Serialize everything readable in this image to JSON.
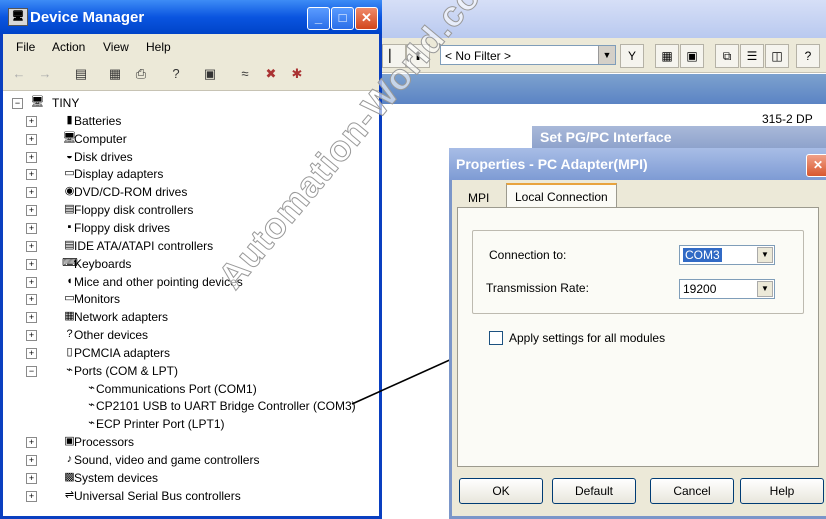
{
  "device_manager": {
    "title": "Device Manager",
    "controls": {
      "minimize": "_",
      "maximize": "□",
      "close": "✕"
    },
    "menu": [
      "File",
      "Action",
      "View",
      "Help"
    ],
    "tree": [
      {
        "label": "TINY",
        "level": 0,
        "state": "-",
        "icon": "computer-icon"
      },
      {
        "label": "Batteries",
        "level": 1,
        "state": "+",
        "icon": "battery-icon"
      },
      {
        "label": "Computer",
        "level": 1,
        "state": "+",
        "icon": "computer-icon"
      },
      {
        "label": "Disk drives",
        "level": 1,
        "state": "+",
        "icon": "disk-icon"
      },
      {
        "label": "Display adapters",
        "level": 1,
        "state": "+",
        "icon": "display-icon"
      },
      {
        "label": "DVD/CD-ROM drives",
        "level": 1,
        "state": "+",
        "icon": "cdrom-icon"
      },
      {
        "label": "Floppy disk controllers",
        "level": 1,
        "state": "+",
        "icon": "controller-icon"
      },
      {
        "label": "Floppy disk drives",
        "level": 1,
        "state": "+",
        "icon": "floppy-icon"
      },
      {
        "label": "IDE ATA/ATAPI controllers",
        "level": 1,
        "state": "+",
        "icon": "controller-icon"
      },
      {
        "label": "Keyboards",
        "level": 1,
        "state": "+",
        "icon": "keyboard-icon"
      },
      {
        "label": "Mice and other pointing devices",
        "level": 1,
        "state": "+",
        "icon": "mouse-icon"
      },
      {
        "label": "Monitors",
        "level": 1,
        "state": "+",
        "icon": "monitor-icon"
      },
      {
        "label": "Network adapters",
        "level": 1,
        "state": "+",
        "icon": "network-icon"
      },
      {
        "label": "Other devices",
        "level": 1,
        "state": "+",
        "icon": "question-icon"
      },
      {
        "label": "PCMCIA adapters",
        "level": 1,
        "state": "+",
        "icon": "pcmcia-icon"
      },
      {
        "label": "Ports (COM & LPT)",
        "level": 1,
        "state": "-",
        "icon": "port-icon"
      },
      {
        "label": "Communications Port (COM1)",
        "level": 2,
        "state": "",
        "icon": "port-icon"
      },
      {
        "label": "CP2101 USB to UART Bridge Controller (COM3)",
        "level": 2,
        "state": "",
        "icon": "port-icon"
      },
      {
        "label": "ECP Printer Port (LPT1)",
        "level": 2,
        "state": "",
        "icon": "port-icon"
      },
      {
        "label": "Processors",
        "level": 1,
        "state": "+",
        "icon": "processor-icon"
      },
      {
        "label": "Sound, video and game controllers",
        "level": 1,
        "state": "+",
        "icon": "sound-icon"
      },
      {
        "label": "System devices",
        "level": 1,
        "state": "+",
        "icon": "system-icon"
      },
      {
        "label": "Universal Serial Bus controllers",
        "level": 1,
        "state": "+",
        "icon": "usb-icon"
      }
    ]
  },
  "background_app": {
    "filter": "< No Filter >",
    "dp_label": "315-2 DP",
    "set_pg_title": "Set PG/PC Interface"
  },
  "properties": {
    "title": "Properties - PC Adapter(MPI)",
    "close": "✕",
    "tabs": [
      "MPI",
      "Local Connection"
    ],
    "connection_label": "Connection to:",
    "connection_value": "COM3",
    "rate_label": "Transmission Rate:",
    "rate_value": "19200",
    "apply_label": "Apply settings for all modules",
    "buttons": {
      "ok": "OK",
      "default": "Default",
      "cancel": "Cancel",
      "help": "Help"
    }
  },
  "watermark": "Automation-World.com",
  "colors": {
    "xp_blue": "#0a55e0",
    "selection": "#316ac5"
  }
}
